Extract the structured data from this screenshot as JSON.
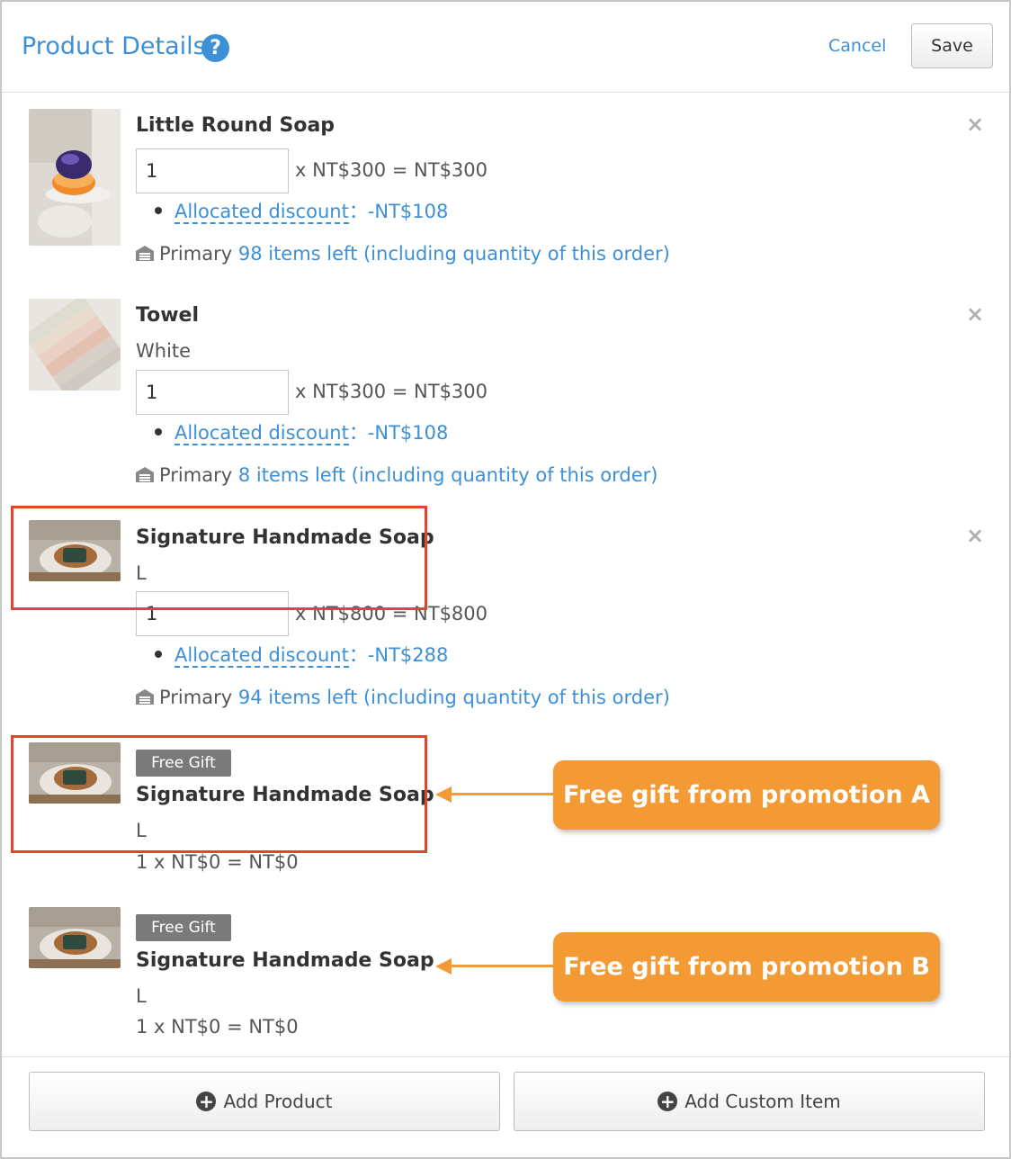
{
  "header": {
    "title": "Product Details",
    "help_icon": "?",
    "cancel_label": "Cancel",
    "save_label": "Save"
  },
  "items": [
    {
      "name": "Little Round Soap",
      "variant": "",
      "quantity": "1",
      "price_line": "x NT$300 = NT$300",
      "discount_label": "Allocated discount",
      "discount_value": "：-NT$108",
      "stock_location": "Primary",
      "stock_text": "98 items left (including quantity of this order)"
    },
    {
      "name": "Towel",
      "variant": "White",
      "quantity": "1",
      "price_line": "x NT$300 = NT$300",
      "discount_label": "Allocated discount",
      "discount_value": "：-NT$108",
      "stock_location": "Primary",
      "stock_text": "8 items left (including quantity of this order)"
    },
    {
      "name": "Signature Handmade Soap",
      "variant": "L",
      "quantity": "1",
      "price_line": "x NT$800 = NT$800",
      "discount_label": "Allocated discount",
      "discount_value": "：-NT$288",
      "stock_location": "Primary",
      "stock_text": "94 items left (including quantity of this order)"
    }
  ],
  "gifts": [
    {
      "badge": "Free Gift",
      "name": "Signature Handmade Soap",
      "variant": "L",
      "price_line": "1 x NT$0 = NT$0",
      "callout": "Free gift from promotion A"
    },
    {
      "badge": "Free Gift",
      "name": "Signature Handmade Soap",
      "variant": "L",
      "price_line": "1 x NT$0 = NT$0",
      "callout": "Free gift from promotion B"
    }
  ],
  "footer": {
    "add_product_label": "Add Product",
    "add_custom_item_label": "Add Custom Item"
  },
  "icons": {
    "remove": "×",
    "plus": "+",
    "warehouse": "warehouse-icon"
  },
  "colors": {
    "accent": "#3d8fd6",
    "callout": "#f39a35",
    "highlight": "#e0462c",
    "badge": "#7a7a7a"
  }
}
